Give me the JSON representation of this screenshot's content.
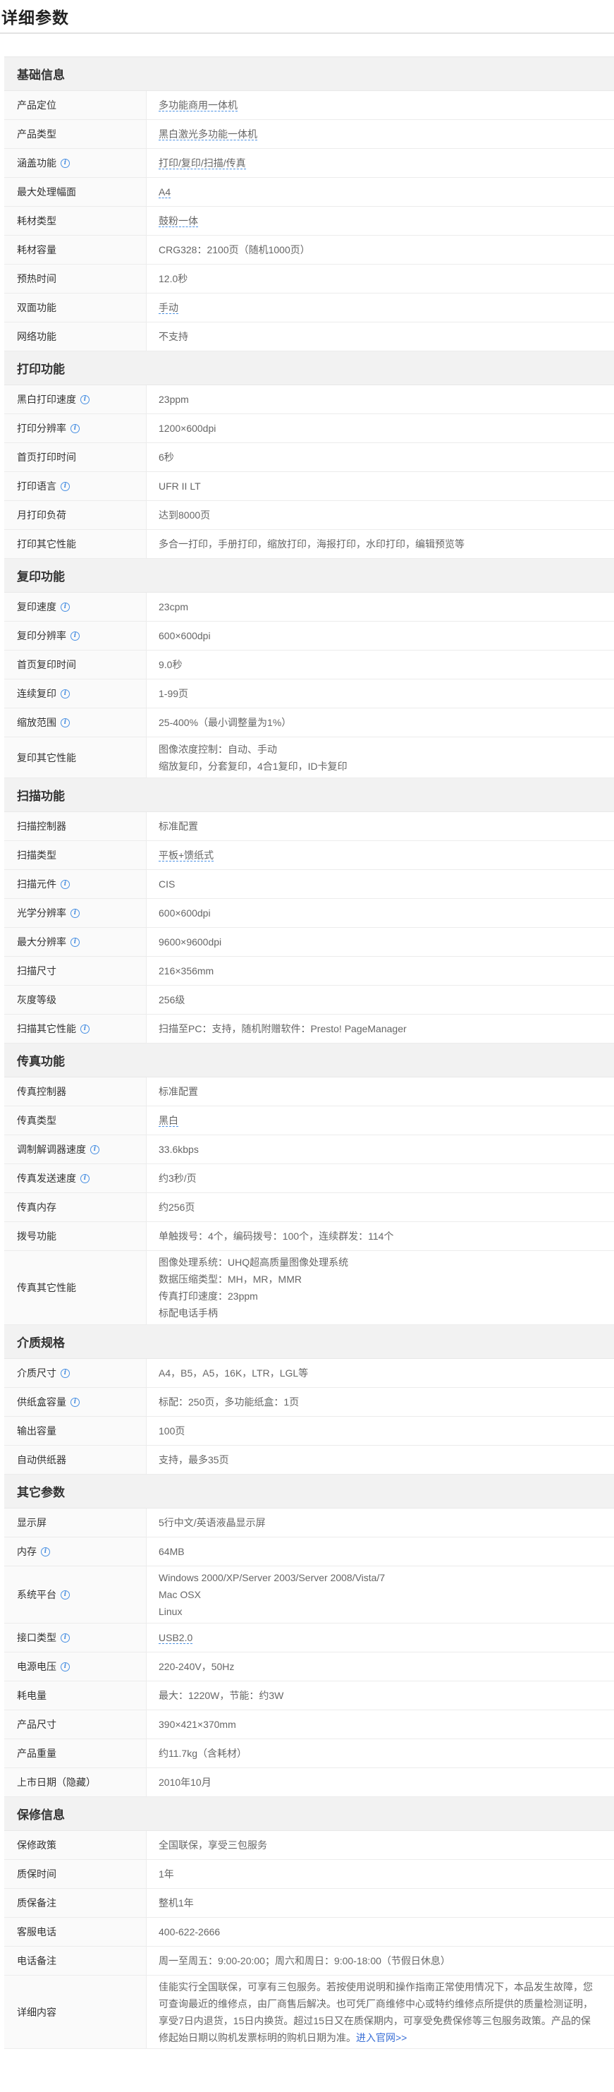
{
  "title": "详细参数",
  "info_icon": "info-icon",
  "colors": {
    "accent": "#4a90e2",
    "section_bg": "#f2f2f2",
    "key_bg": "#fafafa"
  },
  "sections": [
    {
      "title": "基础信息",
      "rows": [
        {
          "k": "产品定位",
          "v": [
            "多功能商用一体机"
          ],
          "info": false,
          "dotted": true,
          "h": 41
        },
        {
          "k": "产品类型",
          "v": [
            "黑白激光多功能一体机"
          ],
          "info": false,
          "dotted": true,
          "h": 41
        },
        {
          "k": "涵盖功能",
          "v": [
            "打印/复印/扫描/传真"
          ],
          "info": true,
          "dotted": true,
          "h": 41
        },
        {
          "k": "最大处理幅面",
          "v": [
            "A4"
          ],
          "info": false,
          "dotted": true,
          "h": 41
        },
        {
          "k": "耗材类型",
          "v": [
            "鼓粉一体"
          ],
          "info": false,
          "dotted": true,
          "h": 41
        },
        {
          "k": "耗材容量",
          "v": [
            "CRG328：2100页（随机1000页）"
          ],
          "info": false,
          "dotted": false,
          "h": 41
        },
        {
          "k": "预热时间",
          "v": [
            "12.0秒"
          ],
          "info": false,
          "dotted": false,
          "h": 41
        },
        {
          "k": "双面功能",
          "v": [
            "手动"
          ],
          "info": false,
          "dotted": true,
          "h": 41
        },
        {
          "k": "网络功能",
          "v": [
            "不支持"
          ],
          "info": false,
          "dotted": false,
          "h": 41
        }
      ]
    },
    {
      "title": "打印功能",
      "rows": [
        {
          "k": "黑白打印速度",
          "v": [
            "23ppm"
          ],
          "info": true,
          "dotted": false,
          "h": 41
        },
        {
          "k": "打印分辨率",
          "v": [
            "1200×600dpi"
          ],
          "info": true,
          "dotted": false,
          "h": 41
        },
        {
          "k": "首页打印时间",
          "v": [
            "6秒"
          ],
          "info": false,
          "dotted": false,
          "h": 41
        },
        {
          "k": "打印语言",
          "v": [
            "UFR II LT"
          ],
          "info": true,
          "dotted": false,
          "h": 41
        },
        {
          "k": "月打印负荷",
          "v": [
            "达到8000页"
          ],
          "info": false,
          "dotted": false,
          "h": 41
        },
        {
          "k": "打印其它性能",
          "v": [
            "多合一打印，手册打印，缩放打印，海报打印，水印打印，编辑预览等"
          ],
          "info": false,
          "dotted": false,
          "h": 41
        }
      ]
    },
    {
      "title": "复印功能",
      "rows": [
        {
          "k": "复印速度",
          "v": [
            "23cpm"
          ],
          "info": true,
          "dotted": false,
          "h": 41
        },
        {
          "k": "复印分辨率",
          "v": [
            "600×600dpi"
          ],
          "info": true,
          "dotted": false,
          "h": 41
        },
        {
          "k": "首页复印时间",
          "v": [
            "9.0秒"
          ],
          "info": false,
          "dotted": false,
          "h": 41
        },
        {
          "k": "连续复印",
          "v": [
            "1-99页"
          ],
          "info": true,
          "dotted": false,
          "h": 41
        },
        {
          "k": "缩放范围",
          "v": [
            "25-400%（最小调整量为1%）"
          ],
          "info": true,
          "dotted": false,
          "h": 41
        },
        {
          "k": "复印其它性能",
          "v": [
            "图像浓度控制：自动、手动",
            "缩放复印，分套复印，4合1复印，ID卡复印"
          ],
          "info": false,
          "dotted": false,
          "h": 58
        }
      ]
    },
    {
      "title": "扫描功能",
      "rows": [
        {
          "k": "扫描控制器",
          "v": [
            "标准配置"
          ],
          "info": false,
          "dotted": false,
          "h": 41
        },
        {
          "k": "扫描类型",
          "v": [
            "平板+馈纸式"
          ],
          "info": false,
          "dotted": true,
          "h": 41
        },
        {
          "k": "扫描元件",
          "v": [
            "CIS"
          ],
          "info": true,
          "dotted": false,
          "h": 41
        },
        {
          "k": "光学分辨率",
          "v": [
            "600×600dpi"
          ],
          "info": true,
          "dotted": false,
          "h": 41
        },
        {
          "k": "最大分辨率",
          "v": [
            "9600×9600dpi"
          ],
          "info": true,
          "dotted": false,
          "h": 41
        },
        {
          "k": "扫描尺寸",
          "v": [
            "216×356mm"
          ],
          "info": false,
          "dotted": false,
          "h": 41
        },
        {
          "k": "灰度等级",
          "v": [
            "256级"
          ],
          "info": false,
          "dotted": false,
          "h": 41
        },
        {
          "k": "扫描其它性能",
          "v": [
            "扫描至PC：支持，随机附赠软件：Presto! PageManager"
          ],
          "info": true,
          "dotted": false,
          "h": 41
        }
      ]
    },
    {
      "title": "传真功能",
      "rows": [
        {
          "k": "传真控制器",
          "v": [
            "标准配置"
          ],
          "info": false,
          "dotted": false,
          "h": 41
        },
        {
          "k": "传真类型",
          "v": [
            "黑白"
          ],
          "info": false,
          "dotted": true,
          "h": 41
        },
        {
          "k": "调制解调器速度",
          "v": [
            "33.6kbps"
          ],
          "info": true,
          "dotted": false,
          "h": 41
        },
        {
          "k": "传真发送速度",
          "v": [
            "约3秒/页"
          ],
          "info": true,
          "dotted": false,
          "h": 41
        },
        {
          "k": "传真内存",
          "v": [
            "约256页"
          ],
          "info": false,
          "dotted": false,
          "h": 41
        },
        {
          "k": "拨号功能",
          "v": [
            "单触拨号：4个，编码拨号：100个，连续群发：114个"
          ],
          "info": false,
          "dotted": false,
          "h": 41
        },
        {
          "k": "传真其它性能",
          "v": [
            "图像处理系统：UHQ超高质量图像处理系统",
            "数据压缩类型：MH，MR，MMR",
            "传真打印速度：23ppm",
            "标配电话手柄"
          ],
          "info": false,
          "dotted": false,
          "h": 105
        }
      ]
    },
    {
      "title": "介质规格",
      "rows": [
        {
          "k": "介质尺寸",
          "v": [
            "A4，B5，A5，16K，LTR，LGL等"
          ],
          "info": true,
          "dotted": false,
          "h": 41
        },
        {
          "k": "供纸盒容量",
          "v": [
            "标配：250页，多功能纸盒：1页"
          ],
          "info": true,
          "dotted": false,
          "h": 41
        },
        {
          "k": "输出容量",
          "v": [
            "100页"
          ],
          "info": false,
          "dotted": false,
          "h": 41
        },
        {
          "k": "自动供纸器",
          "v": [
            "支持，最多35页"
          ],
          "info": false,
          "dotted": false,
          "h": 41
        }
      ]
    },
    {
      "title": "其它参数",
      "rows": [
        {
          "k": "显示屏",
          "v": [
            "5行中文/英语液晶显示屏"
          ],
          "info": false,
          "dotted": false,
          "h": 41
        },
        {
          "k": "内存",
          "v": [
            "64MB"
          ],
          "info": true,
          "dotted": false,
          "h": 41
        },
        {
          "k": "系统平台",
          "v": [
            "Windows 2000/XP/Server 2003/Server 2008/Vista/7",
            "Mac OSX",
            "Linux"
          ],
          "info": true,
          "dotted": false,
          "h": 81
        },
        {
          "k": "接口类型",
          "v": [
            "USB2.0"
          ],
          "info": true,
          "dotted": true,
          "h": 41
        },
        {
          "k": "电源电压",
          "v": [
            "220-240V，50Hz"
          ],
          "info": true,
          "dotted": false,
          "h": 41
        },
        {
          "k": "耗电量",
          "v": [
            "最大：1220W，节能：约3W"
          ],
          "info": false,
          "dotted": false,
          "h": 41
        },
        {
          "k": "产品尺寸",
          "v": [
            "390×421×370mm"
          ],
          "info": false,
          "dotted": false,
          "h": 41
        },
        {
          "k": "产品重量",
          "v": [
            "约11.7kg（含耗材）"
          ],
          "info": false,
          "dotted": false,
          "h": 41
        },
        {
          "k": "上市日期（隐藏）",
          "v": [
            "2010年10月"
          ],
          "info": false,
          "dotted": false,
          "h": 41
        }
      ]
    },
    {
      "title": "保修信息",
      "rows": [
        {
          "k": "保修政策",
          "v": [
            "全国联保，享受三包服务"
          ],
          "info": false,
          "dotted": false,
          "h": 41
        },
        {
          "k": "质保时间",
          "v": [
            "1年"
          ],
          "info": false,
          "dotted": false,
          "h": 41
        },
        {
          "k": "质保备注",
          "v": [
            "整机1年"
          ],
          "info": false,
          "dotted": false,
          "h": 41
        },
        {
          "k": "客服电话",
          "v": [
            "400-622-2666"
          ],
          "info": false,
          "dotted": false,
          "h": 41
        },
        {
          "k": "电话备注",
          "v": [
            "周一至周五：9:00-20:00；周六和周日：9:00-18:00（节假日休息）"
          ],
          "info": false,
          "dotted": false,
          "h": 41
        },
        {
          "k": "详细内容",
          "v": [
            "佳能实行全国联保，可享有三包服务。若按使用说明和操作指南正常使用情况下，本品发生故障，您",
            "可查询最近的维修点，由厂商售后解决。也可凭厂商维修中心或特约维修点所提供的质量检测证明，",
            "享受7日内退货，15日内换货。超过15日又在质保期内，可享受免费保修等三包服务政策。产品的保",
            "修起始日期以购机发票标明的购机日期为准。"
          ],
          "info": false,
          "dotted": false,
          "h": 104,
          "more": "进入官网>>"
        }
      ]
    }
  ]
}
